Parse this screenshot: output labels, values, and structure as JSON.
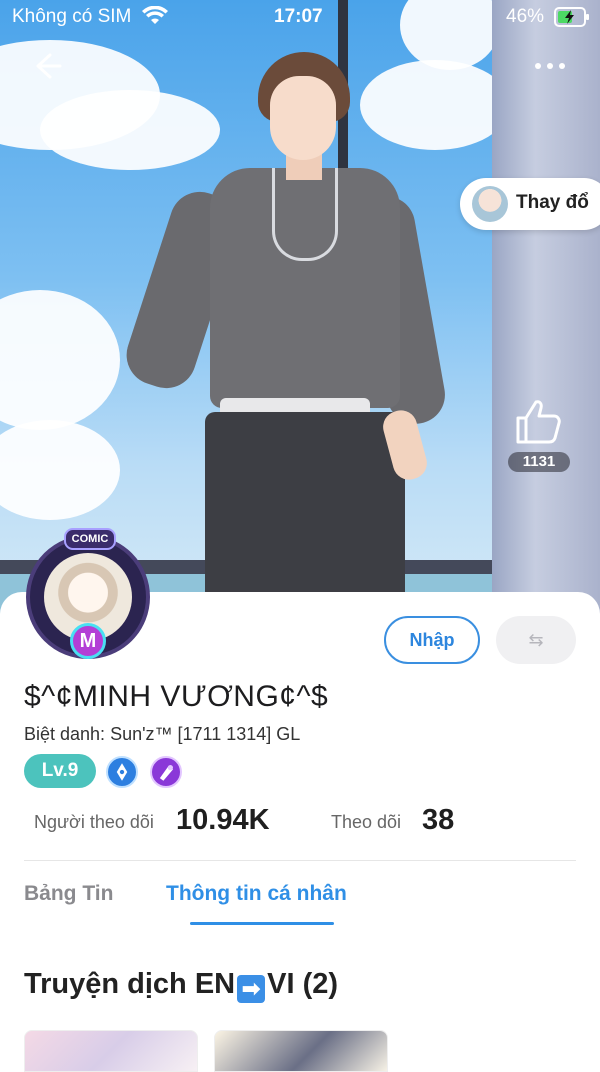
{
  "status_bar": {
    "carrier": "Không có SIM",
    "time": "17:07",
    "battery_percent": "46%"
  },
  "hero": {
    "change_label": "Thay đổ",
    "like_count": "1131"
  },
  "profile": {
    "avatar_tag": "COMIC",
    "avatar_letter": "M",
    "enter_button": "Nhập",
    "swap_button": "⇆",
    "username": "$^¢MINH VƯƠNG¢^$",
    "nickname": "Biệt danh: Sun'z™ [1711 1314] GL",
    "level": "Lv.9",
    "followers_label": "Người theo dõi",
    "followers_value": "10.94K",
    "following_label": "Theo dõi",
    "following_value": "38"
  },
  "tabs": [
    {
      "label": "Bảng Tin",
      "active": false
    },
    {
      "label": "Thông tin cá nhân",
      "active": true
    }
  ],
  "section": {
    "title_prefix": "Truyện dịch EN",
    "title_suffix": "VI (2)",
    "arrow": "➡"
  },
  "colors": {
    "accent": "#2f8fe6",
    "level_badge": "#4cc3bd"
  }
}
